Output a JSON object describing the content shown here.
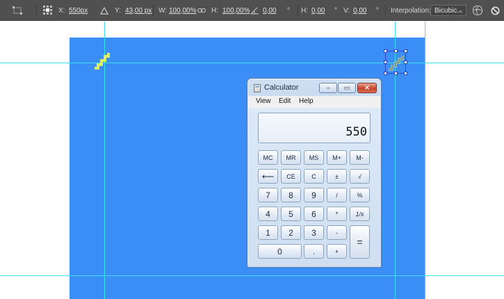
{
  "options_bar": {
    "x_label": "X:",
    "x_value": "550px",
    "y_label": "Y:",
    "y_value": "43,00 px",
    "w_label": "W:",
    "w_value": "100,00%",
    "h_label": "H:",
    "h_value": "100,00%",
    "angle_value": "0,00",
    "angle_unit": "°",
    "hskew_label": "H:",
    "hskew_value": "0,00",
    "hskew_unit": "°",
    "vskew_label": "V:",
    "vskew_value": "0,00",
    "vskew_unit": "°",
    "interpolation_label": "Interpolation:",
    "interpolation_value": "Bicubic...",
    "icons": [
      "reference-point-icon",
      "triangle-icon",
      "link-icon",
      "angle-icon",
      "warp-icon",
      "cancel-icon"
    ]
  },
  "canvas": {
    "document_color": "#3a8ef6",
    "guide_color": "#3ce0ee",
    "stairs_color": "#d9f06a"
  },
  "calculator": {
    "title": "Calculator",
    "window_buttons": {
      "minimize": "–",
      "maximize": "▭",
      "close": "✕"
    },
    "menu": [
      "View",
      "Edit",
      "Help"
    ],
    "display_value": "550",
    "keys": {
      "mc": "MC",
      "mr": "MR",
      "ms": "MS",
      "mplus": "M+",
      "mminus": "M-",
      "backspace": "⟵",
      "ce": "CE",
      "c": "C",
      "plusminus": "±",
      "sqrt": "√",
      "n7": "7",
      "n8": "8",
      "n9": "9",
      "divide": "/",
      "percent": "%",
      "n4": "4",
      "n5": "5",
      "n6": "6",
      "multiply": "*",
      "reciprocal": "1/x",
      "n1": "1",
      "n2": "2",
      "n3": "3",
      "minus": "-",
      "equals": "=",
      "n0": "0",
      "decimal": ",",
      "plus": "+"
    }
  }
}
